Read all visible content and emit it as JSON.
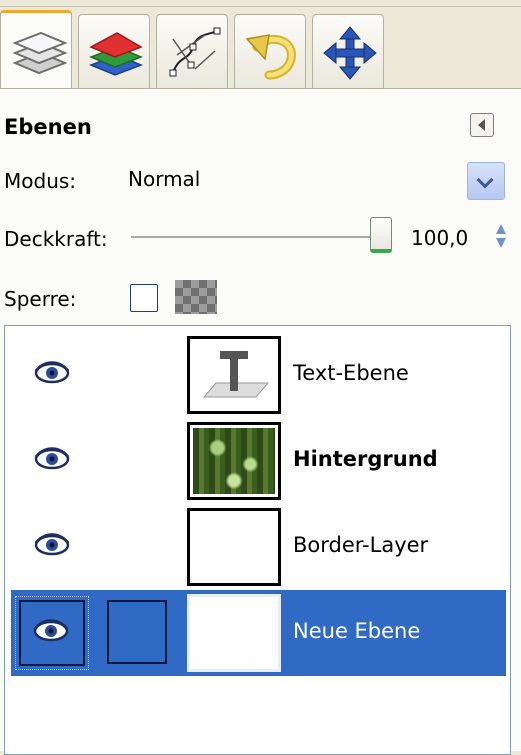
{
  "tabs": [
    {
      "icon": "layers-icon",
      "active": true
    },
    {
      "icon": "channels-icon",
      "active": false
    },
    {
      "icon": "paths-icon",
      "active": false
    },
    {
      "icon": "undo-icon",
      "active": false
    },
    {
      "icon": "move-icon",
      "active": false
    }
  ],
  "panel": {
    "title": "Ebenen",
    "mode_label": "Modus:",
    "mode_value": "Normal",
    "opacity_label": "Deckkraft:",
    "opacity_value": "100,0",
    "opacity_fraction": 1.0,
    "lock_label": "Sperre:"
  },
  "layers": [
    {
      "name": "Text-Ebene",
      "thumb": "text",
      "visible": true,
      "bold": false,
      "selected": false
    },
    {
      "name": "Hintergrund",
      "thumb": "forest",
      "visible": true,
      "bold": true,
      "selected": false
    },
    {
      "name": "Border-Layer",
      "thumb": "checker",
      "visible": true,
      "bold": false,
      "selected": false
    },
    {
      "name": "Neue Ebene",
      "thumb": "checker",
      "visible": true,
      "bold": false,
      "selected": true
    }
  ],
  "colors": {
    "selection": "#316ac5",
    "accent_tab": "#f0a72b",
    "slider_thumb": "#36a84d"
  }
}
